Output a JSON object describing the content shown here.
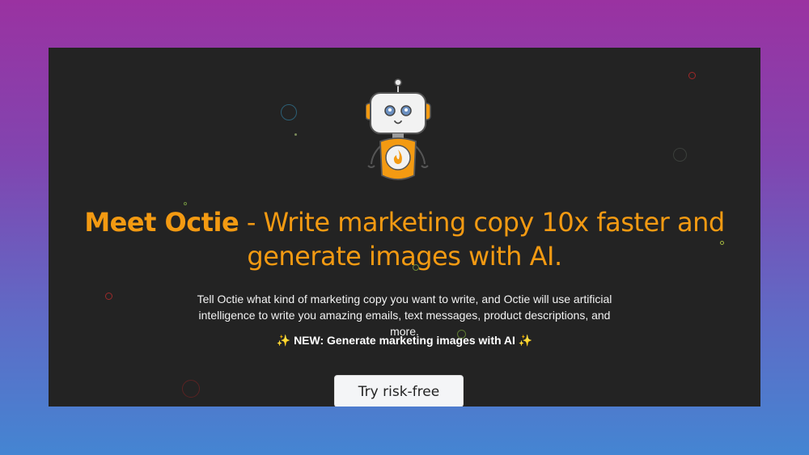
{
  "hero": {
    "headline_brand": "Meet Octie",
    "headline_rest": " - Write marketing copy 10x faster and generate images with AI.",
    "description": "Tell Octie what kind of marketing copy you want to write, and Octie will use artificial intelligence to write you amazing emails, text messages, product descriptions, and more.",
    "new_text": "NEW: Generate marketing images with AI",
    "sparkle": "✨",
    "cta_label": "Try risk-free"
  },
  "colors": {
    "accent": "#f39a12",
    "panel_background": "#232323",
    "gradient_top": "#9a32a1",
    "gradient_bottom": "#4485d2"
  },
  "icons": {
    "mascot": "robot-mascot-icon",
    "sparkle": "sparkle-icon"
  }
}
